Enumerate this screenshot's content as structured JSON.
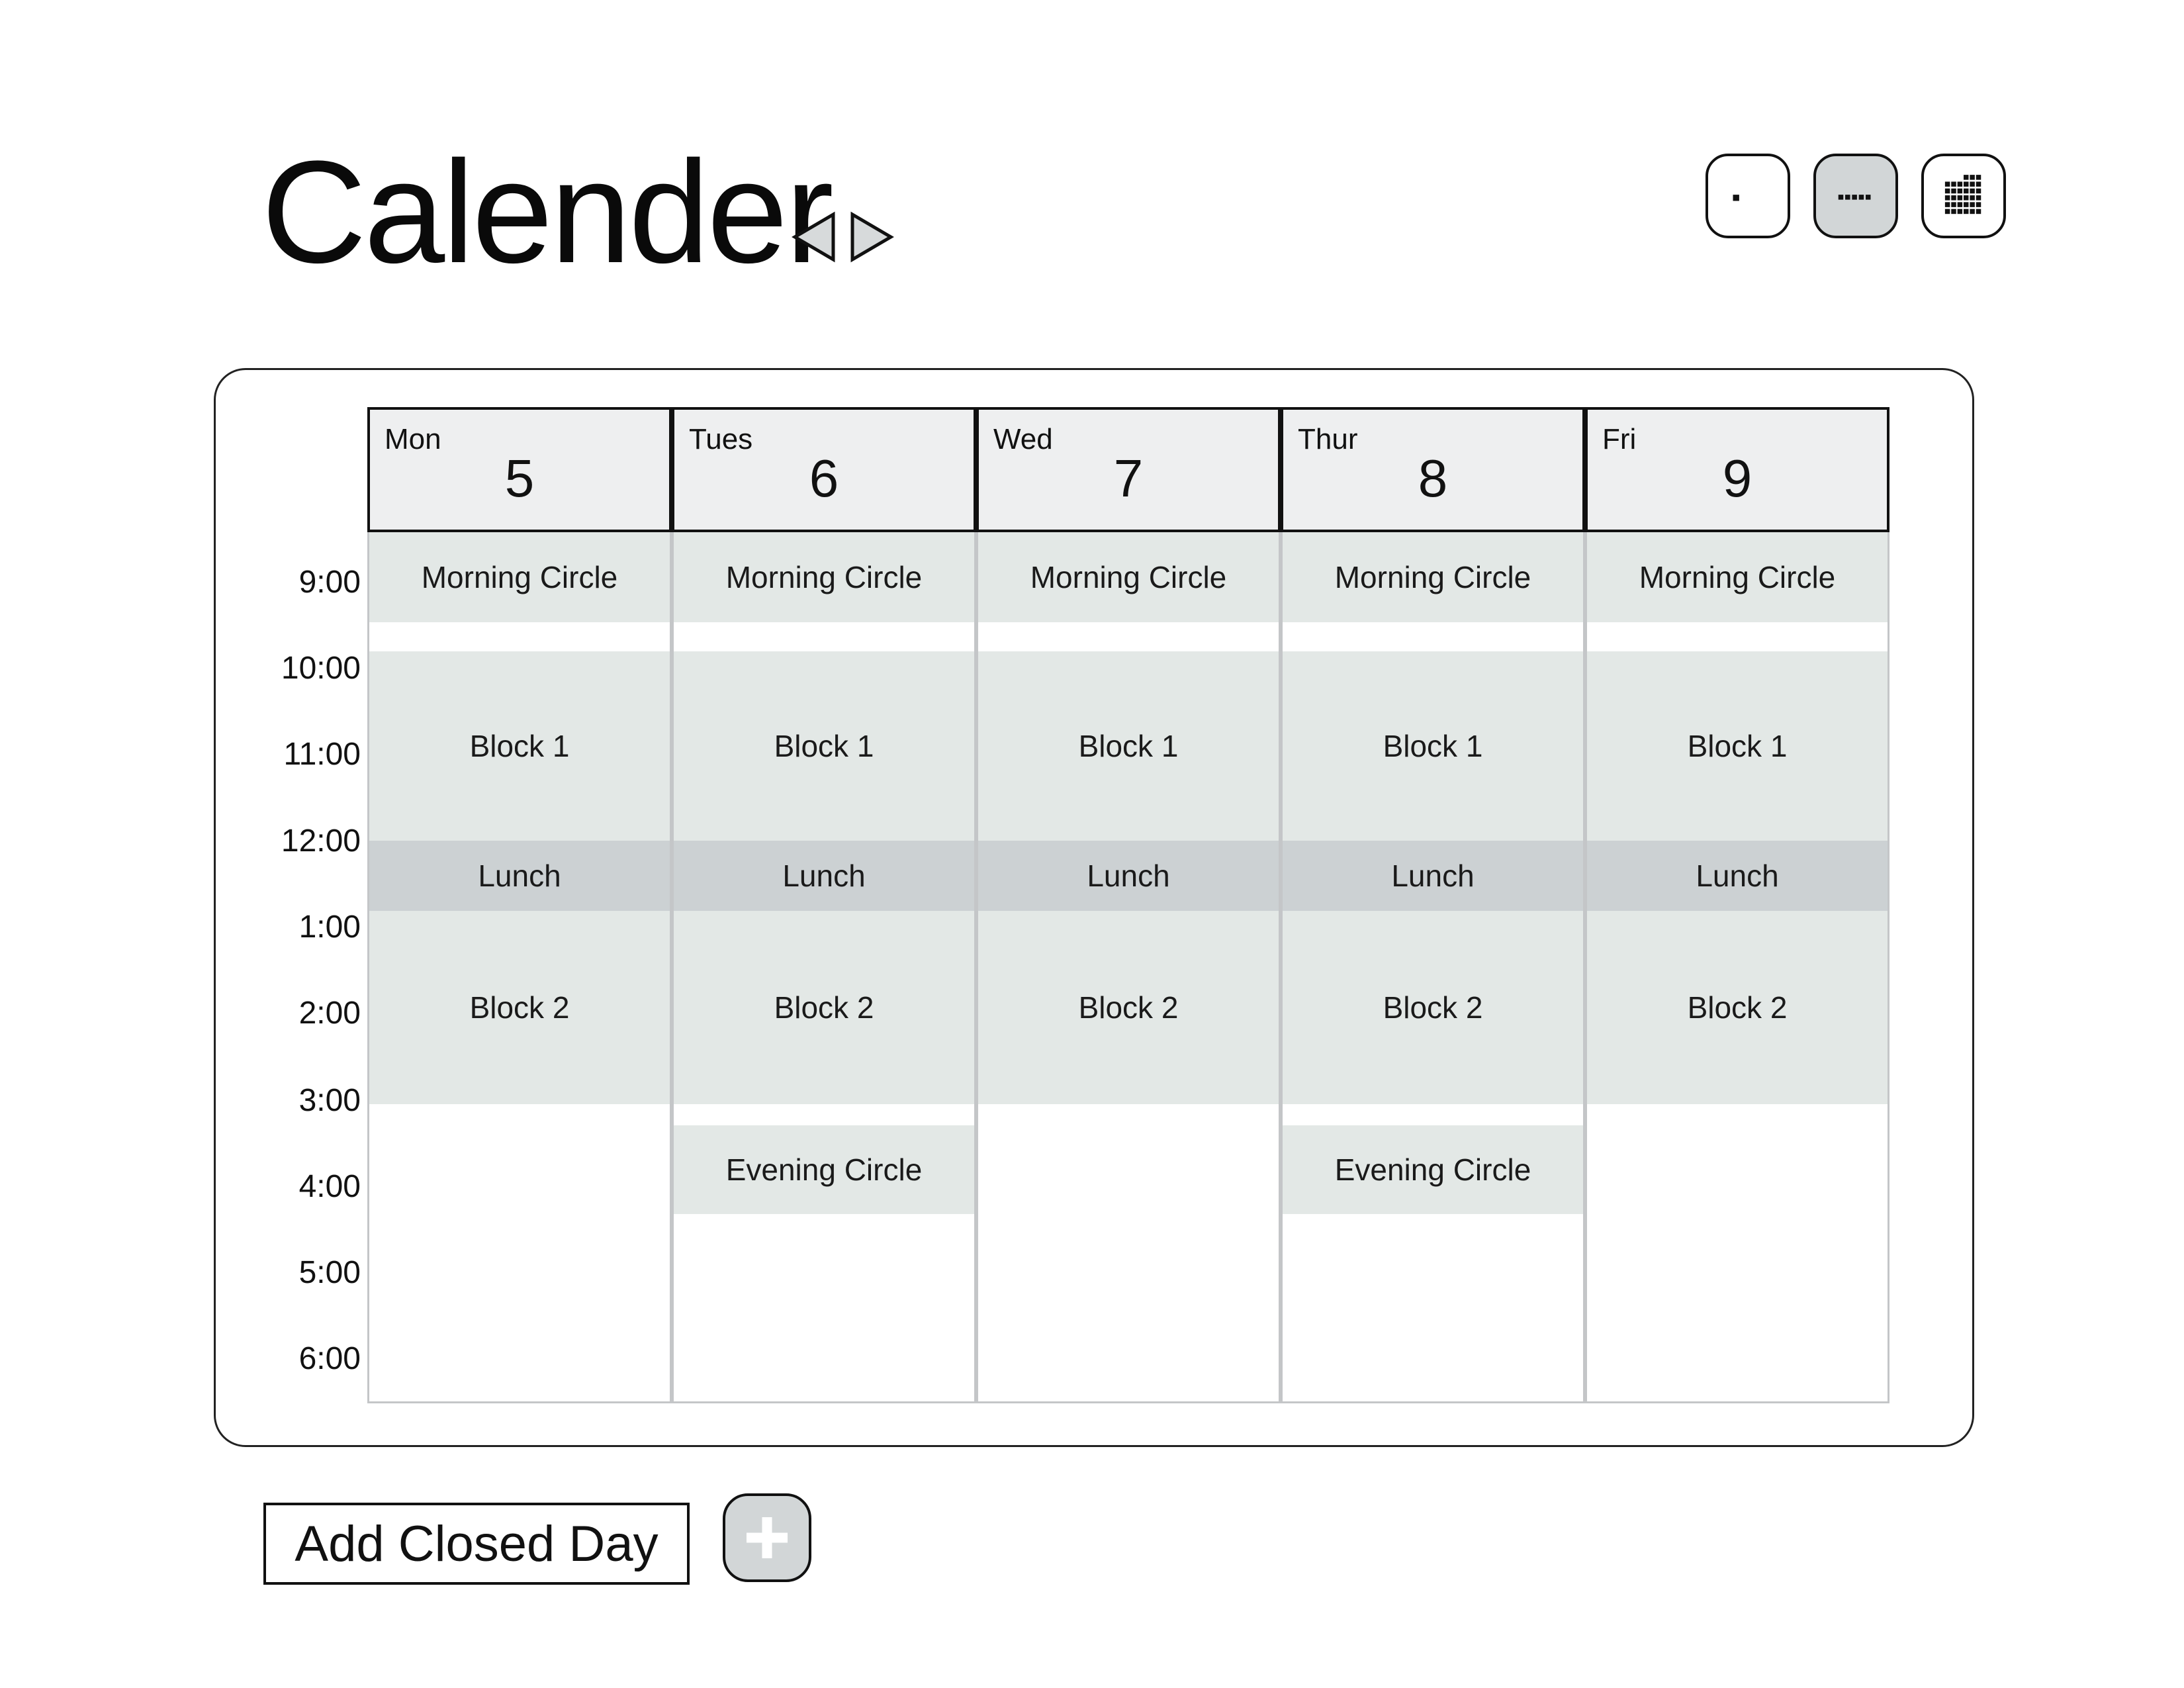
{
  "header": {
    "title": "Calender",
    "nav": {
      "prev_icon": "triangle-left-icon",
      "next_icon": "triangle-right-icon"
    },
    "view_buttons": [
      {
        "name": "day-view-button",
        "icon": "single-dot-icon",
        "active": false
      },
      {
        "name": "week-view-button",
        "icon": "dot-row-icon",
        "active": true
      },
      {
        "name": "month-view-button",
        "icon": "dot-grid-icon",
        "active": false
      }
    ]
  },
  "calendar": {
    "times": [
      "9:00",
      "10:00",
      "11:00",
      "12:00",
      "1:00",
      "2:00",
      "3:00",
      "4:00",
      "5:00",
      "6:00"
    ],
    "days": [
      {
        "dow": "Mon",
        "date": "5",
        "events": {
          "morning": "Morning Circle",
          "block1": "Block 1",
          "lunch": "Lunch",
          "block2": "Block 2",
          "evening": ""
        }
      },
      {
        "dow": "Tues",
        "date": "6",
        "events": {
          "morning": "Morning Circle",
          "block1": "Block 1",
          "lunch": "Lunch",
          "block2": "Block 2",
          "evening": "Evening Circle"
        }
      },
      {
        "dow": "Wed",
        "date": "7",
        "events": {
          "morning": "Morning Circle",
          "block1": "Block 1",
          "lunch": "Lunch",
          "block2": "Block 2",
          "evening": ""
        }
      },
      {
        "dow": "Thur",
        "date": "8",
        "events": {
          "morning": "Morning Circle",
          "block1": "Block 1",
          "lunch": "Lunch",
          "block2": "Block 2",
          "evening": "Evening Circle"
        }
      },
      {
        "dow": "Fri",
        "date": "9",
        "events": {
          "morning": "Morning Circle",
          "block1": "Block 1",
          "lunch": "Lunch",
          "block2": "Block 2",
          "evening": ""
        }
      }
    ]
  },
  "footer": {
    "add_closed_day_label": "Add Closed Day",
    "add_icon": "plus-icon"
  },
  "colors": {
    "event_fill": "#e3e8e6",
    "lunch_fill": "#ccd1d3",
    "header_fill": "#eeeff0",
    "active_button_fill": "#d2d6d7"
  }
}
